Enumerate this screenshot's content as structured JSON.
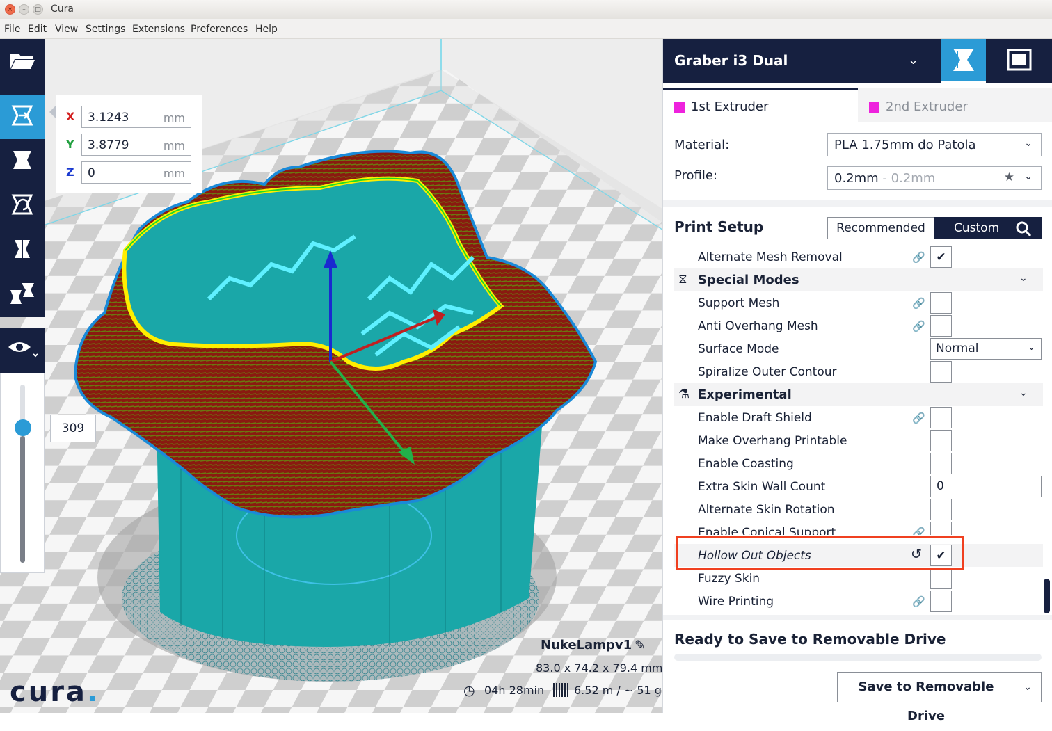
{
  "window": {
    "title": "Cura",
    "close_glyph": "×",
    "min_glyph": "–",
    "max_glyph": "□"
  },
  "menu": [
    "File",
    "Edit",
    "View",
    "Settings",
    "Extensions",
    "Preferences",
    "Help"
  ],
  "move_tool": {
    "x_label": "X",
    "x_value": "3.1243",
    "y_label": "Y",
    "y_value": "3.8779",
    "z_label": "Z",
    "z_value": "0",
    "unit": "mm"
  },
  "layer_view": {
    "current_layer": "309",
    "position_fraction": 0.29
  },
  "job": {
    "name": "NukeLampv1",
    "dimensions": "83.0 x 74.2 x 79.4 mm",
    "print_time": "04h 28min",
    "material_usage": "6.52 m / ~ 51 g"
  },
  "logo": {
    "text": "cura",
    "dot": "."
  },
  "machine": {
    "name": "Graber i3 Dual"
  },
  "extruders": [
    {
      "label": "1st Extruder",
      "color": "#ee22dd"
    },
    {
      "label": "2nd Extruder",
      "color": "#ee22dd"
    }
  ],
  "material": {
    "label": "Material:",
    "value": "PLA 1.75mm do Patola"
  },
  "profile": {
    "label": "Profile:",
    "value": "0.2mm",
    "secondary": " - 0.2mm"
  },
  "print_setup": {
    "title": "Print Setup",
    "recommended_label": "Recommended",
    "custom_label": "Custom"
  },
  "settings": {
    "alternate_mesh_removal": {
      "label": "Alternate Mesh Removal",
      "checked": "✔"
    },
    "special_modes": {
      "label": "Special Modes"
    },
    "support_mesh": {
      "label": "Support Mesh"
    },
    "anti_overhang_mesh": {
      "label": "Anti Overhang Mesh"
    },
    "surface_mode": {
      "label": "Surface Mode",
      "value": "Normal"
    },
    "spiralize": {
      "label": "Spiralize Outer Contour"
    },
    "experimental": {
      "label": "Experimental"
    },
    "draft_shield": {
      "label": "Enable Draft Shield"
    },
    "overhang_printable": {
      "label": "Make Overhang Printable"
    },
    "coasting": {
      "label": "Enable Coasting"
    },
    "extra_skin_wall_count": {
      "label": "Extra Skin Wall Count",
      "value": "0"
    },
    "alternate_skin_rotation": {
      "label": "Alternate Skin Rotation"
    },
    "conical_support": {
      "label": "Enable Conical Support"
    },
    "hollow_out": {
      "label": "Hollow Out Objects",
      "checked": "✔"
    },
    "fuzzy_skin": {
      "label": "Fuzzy Skin"
    },
    "wire_printing": {
      "label": "Wire Printing"
    }
  },
  "output": {
    "status_title": "Ready to Save to Removable Drive",
    "save_label": "Save to Removable Drive"
  },
  "colors": {
    "brand_dark": "#162040",
    "accent": "#2b9bd6",
    "highlight": "#f04020",
    "model_teal": "#1aa7a8"
  }
}
